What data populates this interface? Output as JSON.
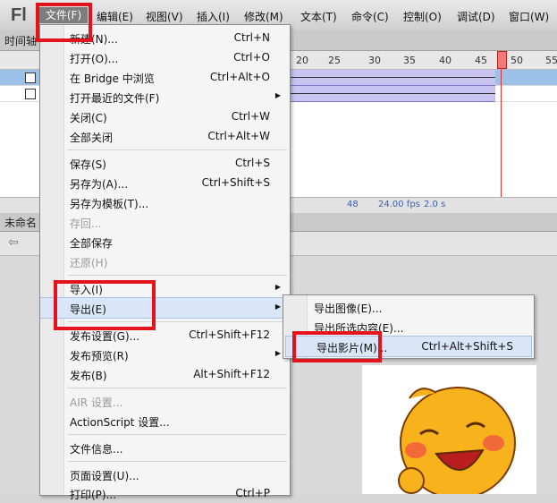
{
  "app": {
    "logo": "Fl"
  },
  "menubar": {
    "items": [
      "文件(F)",
      "编辑(E)",
      "视图(V)",
      "插入(I)",
      "修改(M)",
      "文本(T)",
      "命令(C)",
      "控制(O)",
      "调试(D)",
      "窗口(W)"
    ]
  },
  "timeline": {
    "tab_label": "时间轴",
    "ruler_ticks": [
      "20",
      "25",
      "30",
      "35",
      "40",
      "45",
      "50",
      "55"
    ],
    "status": {
      "frame": "48",
      "fps": "24.00 fps",
      "time": "2.0 s"
    }
  },
  "document": {
    "tab_label": "未命名"
  },
  "file_menu": {
    "items": [
      {
        "label": "新建(N)...",
        "shortcut": "Ctrl+N"
      },
      {
        "label": "打开(O)...",
        "shortcut": "Ctrl+O"
      },
      {
        "label": "在 Bridge 中浏览",
        "shortcut": "Ctrl+Alt+O"
      },
      {
        "label": "打开最近的文件(F)",
        "shortcut": ""
      },
      {
        "label": "关闭(C)",
        "shortcut": "Ctrl+W"
      },
      {
        "label": "全部关闭",
        "shortcut": "Ctrl+Alt+W"
      },
      {
        "label": "保存(S)",
        "shortcut": "Ctrl+S"
      },
      {
        "label": "另存为(A)...",
        "shortcut": "Ctrl+Shift+S"
      },
      {
        "label": "另存为模板(T)...",
        "shortcut": ""
      },
      {
        "label": "存回...",
        "shortcut": ""
      },
      {
        "label": "全部保存",
        "shortcut": ""
      },
      {
        "label": "还原(H)",
        "shortcut": ""
      },
      {
        "label": "导入(I)",
        "shortcut": ""
      },
      {
        "label": "导出(E)",
        "shortcut": ""
      },
      {
        "label": "发布设置(G)...",
        "shortcut": "Ctrl+Shift+F12"
      },
      {
        "label": "发布预览(R)",
        "shortcut": ""
      },
      {
        "label": "发布(B)",
        "shortcut": "Alt+Shift+F12"
      },
      {
        "label": "AIR 设置...",
        "shortcut": ""
      },
      {
        "label": "ActionScript 设置...",
        "shortcut": ""
      },
      {
        "label": "文件信息...",
        "shortcut": ""
      },
      {
        "label": "页面设置(U)...",
        "shortcut": ""
      },
      {
        "label": "打印(P)...",
        "shortcut": "Ctrl+P"
      }
    ]
  },
  "export_submenu": {
    "items": [
      {
        "label": "导出图像(E)...",
        "shortcut": ""
      },
      {
        "label": "导出所选内容(E)...",
        "shortcut": ""
      },
      {
        "label": "导出影片(M)...",
        "shortcut": "Ctrl+Alt+Shift+S"
      }
    ]
  },
  "colors": {
    "annotation_red": "#e3121b",
    "highlight": "#d8e6f7",
    "playhead": "#e03030",
    "tween": "#c9c3f2"
  }
}
